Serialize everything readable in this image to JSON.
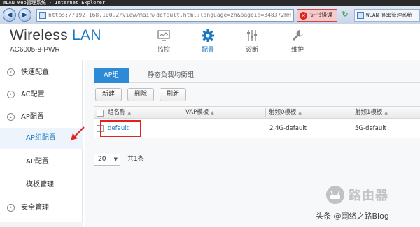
{
  "window": {
    "title": "WLAN Web管理系统 - Internet Explorer"
  },
  "browser": {
    "url": "https://192.168.100.2/view/main/default.html?language=zh&pageid=348372HH",
    "cert_error": "证书错误",
    "tab_title": "WLAN Web管理系统"
  },
  "header": {
    "brand_main": "Wireless",
    "brand_accent": "LAN",
    "model": "AC6005-8-PWR",
    "nav": [
      {
        "label": "监控",
        "icon": "monitor-icon",
        "active": false
      },
      {
        "label": "配置",
        "icon": "gear-icon",
        "active": true
      },
      {
        "label": "诊断",
        "icon": "sliders-icon",
        "active": false
      },
      {
        "label": "维护",
        "icon": "wrench-icon",
        "active": false
      }
    ]
  },
  "sidebar": {
    "items": [
      {
        "label": "快速配置"
      },
      {
        "label": "AC配置"
      },
      {
        "label": "AP配置"
      }
    ],
    "sub_items": [
      {
        "label": "AP组配置",
        "active": true
      },
      {
        "label": "AP配置",
        "active": false
      },
      {
        "label": "模板管理",
        "active": false
      }
    ],
    "bottom_item": {
      "label": "安全管理"
    }
  },
  "main": {
    "tabs": [
      {
        "label": "AP组",
        "active": true
      },
      {
        "label": "静态负载均衡组",
        "active": false
      }
    ],
    "toolbar": {
      "new": "新建",
      "delete": "删除",
      "refresh": "刷新"
    },
    "table": {
      "columns": [
        "组名称",
        "VAP模板",
        "射频0模板",
        "射频1模板"
      ],
      "rows": [
        {
          "group_name": "default",
          "vap": "",
          "radio0": "2.4G-default",
          "radio1": "5G-default"
        }
      ]
    },
    "pager": {
      "page_size": "20",
      "total": "共1条"
    }
  },
  "watermark": {
    "logo_text": "路由器",
    "credit": "头条 @网络之路Blog"
  },
  "colors": {
    "accent": "#1a78c2",
    "annotation_red": "#e52222"
  }
}
